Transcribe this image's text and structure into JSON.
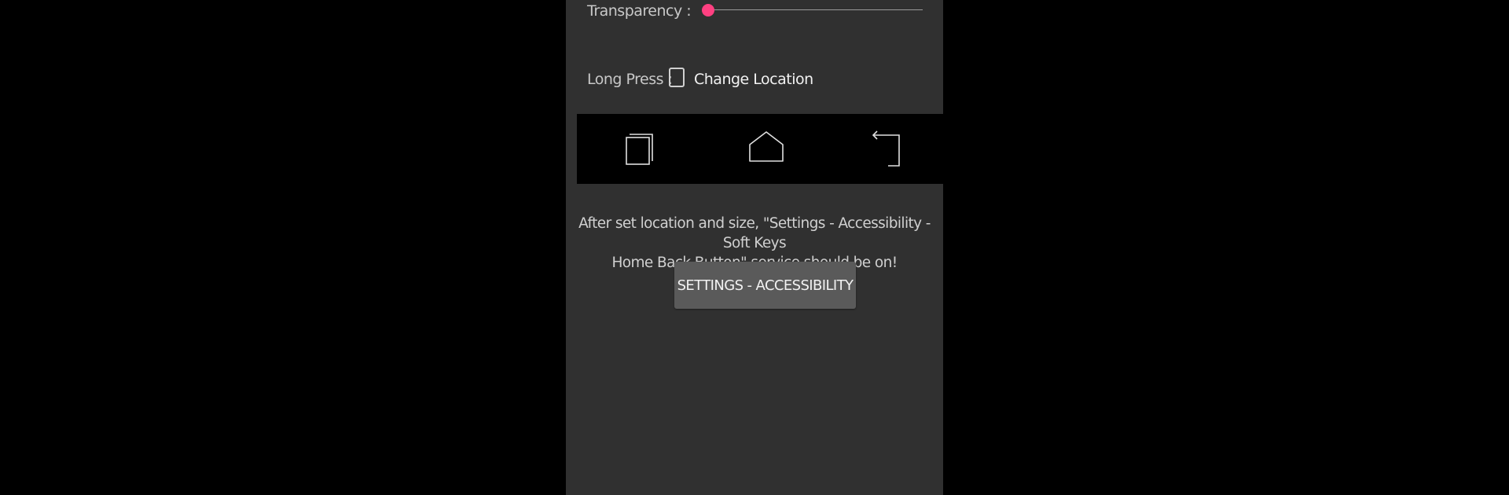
{
  "colors": {
    "screen_background": "#303030",
    "outer_background": "#000000",
    "accent": "#ff4081",
    "navbar_background": "#000000",
    "button_background": "#5a5a5a"
  },
  "transparency": {
    "label": "Transparency :",
    "value_fraction": 0.0
  },
  "long_press": {
    "label": "Long Press :",
    "checkbox_label": "Change Location",
    "checked": false
  },
  "navbar": {
    "icons": [
      "recents-icon",
      "home-icon",
      "back-icon"
    ]
  },
  "info": {
    "text": "After set location and size, \"Settings - Accessibility - Soft Keys\nHome Back Button\" service should be on!"
  },
  "settings_button": {
    "label": "SETTINGS - ACCESSIBILITY"
  }
}
